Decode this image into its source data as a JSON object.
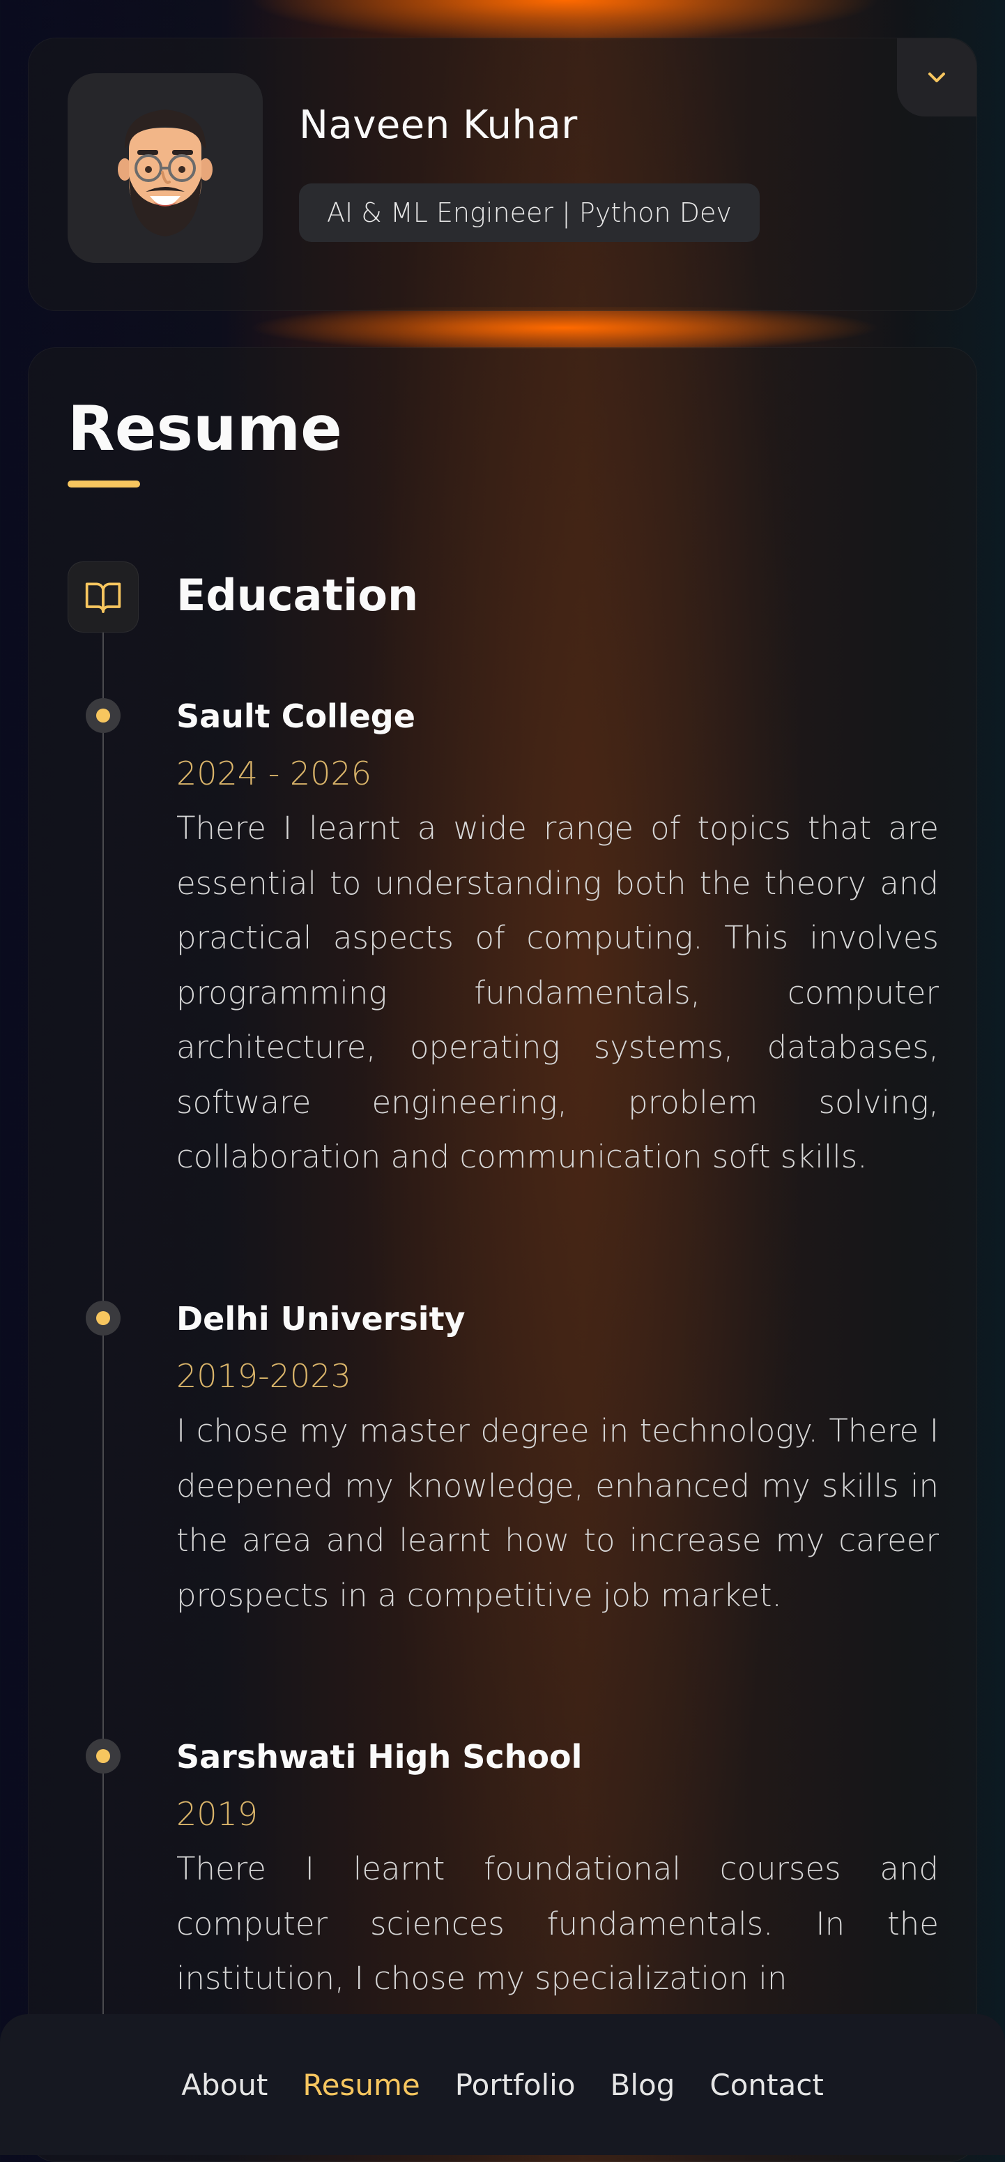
{
  "profile": {
    "name": "Naveen Kuhar",
    "title": "AI & ML Engineer | Python Dev",
    "avatar_icon": "memoji-avatar",
    "expand_icon": "chevron-down-icon"
  },
  "resume": {
    "page_title": "Resume",
    "section_icon": "book-open-icon",
    "section_title": "Education",
    "entries": [
      {
        "name": "Sault College",
        "date": "2024 - 2026",
        "description": "There I learnt a wide range of topics that are essential to understanding both the theory and practical aspects of computing. This involves programming fundamentals, computer architecture, operating systems, databases, software engineering, problem solving, collaboration and communication soft skills."
      },
      {
        "name": "Delhi University",
        "date": "2019-2023",
        "description": "I chose my master degree in technology. There I deepened my knowledge, enhanced my skills in the area and learnt how to increase my career prospects in a competitive job market."
      },
      {
        "name": "Sarshwati High School",
        "date": "2019",
        "description": "There I learnt foundational courses and computer sciences fundamentals. In the institution, I chose my specialization in"
      }
    ]
  },
  "nav": {
    "items": [
      "About",
      "Resume",
      "Portfolio",
      "Blog",
      "Contact"
    ],
    "active": "Resume"
  },
  "colors": {
    "accent": "#f7c65f",
    "date": "#d9b46a",
    "glow": "#ff6a00"
  }
}
